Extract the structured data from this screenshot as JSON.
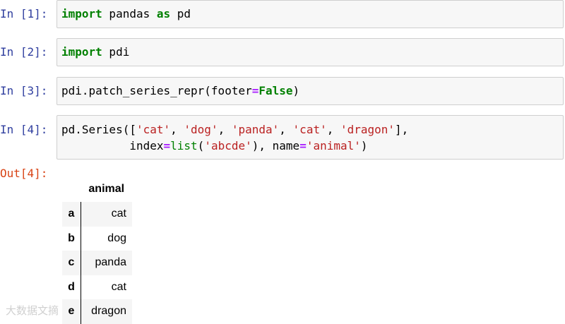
{
  "cells": [
    {
      "prompt": "In [1]:",
      "code": [
        {
          "kw": "import"
        },
        {
          "t": " pandas "
        },
        {
          "kw": "as"
        },
        {
          "t": " pd"
        }
      ]
    },
    {
      "prompt": "In [2]:",
      "code": [
        {
          "kw": "import"
        },
        {
          "t": " pdi"
        }
      ]
    },
    {
      "prompt": "In [3]:",
      "code": [
        {
          "t": "pdi.patch_series_repr(footer"
        },
        {
          "op": "="
        },
        {
          "kw": "False"
        },
        {
          "t": ")"
        }
      ]
    },
    {
      "prompt": "In [4]:",
      "line1": [
        {
          "t": "pd.Series(["
        },
        {
          "str": "'cat'"
        },
        {
          "t": ", "
        },
        {
          "str": "'dog'"
        },
        {
          "t": ", "
        },
        {
          "str": "'panda'"
        },
        {
          "t": ", "
        },
        {
          "str": "'cat'"
        },
        {
          "t": ", "
        },
        {
          "str": "'dragon'"
        },
        {
          "t": "],"
        }
      ],
      "line2": [
        {
          "t": "          index"
        },
        {
          "op": "="
        },
        {
          "bi": "list"
        },
        {
          "t": "("
        },
        {
          "str": "'abcde'"
        },
        {
          "t": "), name"
        },
        {
          "op": "="
        },
        {
          "str": "'animal'"
        },
        {
          "t": ")"
        }
      ]
    }
  ],
  "output": {
    "prompt": "Out[4]:",
    "column_header": "animal",
    "rows": [
      {
        "index": "a",
        "value": "cat"
      },
      {
        "index": "b",
        "value": "dog"
      },
      {
        "index": "c",
        "value": "panda"
      },
      {
        "index": "d",
        "value": "cat"
      },
      {
        "index": "e",
        "value": "dragon"
      }
    ]
  },
  "watermark": "大数据文摘"
}
